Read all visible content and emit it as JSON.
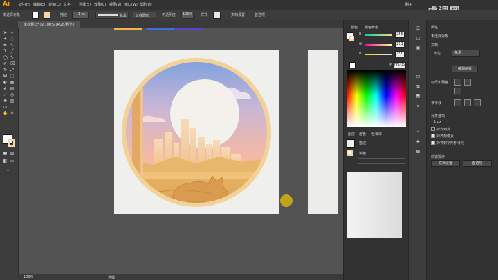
{
  "app": {
    "logo": "Ai"
  },
  "menubar": {
    "items": [
      "文件(F)",
      "编辑(E)",
      "对象(O)",
      "文字(T)",
      "选择(S)",
      "效果(C)",
      "视图(V)",
      "窗口(W)",
      "帮助(H)"
    ],
    "user": "刷子"
  },
  "watermark": "虎课网",
  "controlbar": {
    "no_selection": "未选择对象",
    "stroke_label": "描边",
    "stroke_weight": "1 pt",
    "stroke_style": "基本",
    "brush_label": "5 点圆形",
    "opacity_label": "不透明度",
    "opacity_value": "100%",
    "style_label": "样式",
    "doc_setup": "文档设置",
    "prefs": "首选项"
  },
  "document": {
    "tab_title": "未标题-3* @ 100% (RGB/预览)",
    "zoom": "100%",
    "status_tool": "选择"
  },
  "color_panel": {
    "tab_color": "颜色",
    "tab_guide": "颜色参考",
    "r_value": "255",
    "g_value": "211",
    "b_value": "150",
    "hex_label": "#",
    "hex_value": "FFD396",
    "r_label": "R",
    "g_label": "G",
    "b_label": "B"
  },
  "layers_panel": {
    "tab_layers": "图层",
    "tab_artboards": "画板",
    "tab_swatches": "色板库",
    "row1": "描边",
    "row2": "填色"
  },
  "properties_panel": {
    "title": "属性",
    "no_selection": "未选择对象",
    "doc_section": "文档",
    "units_label": "单位:",
    "units_value": "像素",
    "edit_artboard_btn": "编辑画板",
    "ruler_section": "标尺和网格",
    "guides_section": "参考线",
    "snap_section": "对齐选项",
    "snap_spacing": "1 px",
    "snap_opt1": "对齐到点",
    "snap_opt2": "对齐到像素",
    "snap_opt3": "对齐到字形参考线",
    "quick_section": "快速操作",
    "doc_setup_btn": "文档设置",
    "prefs_btn": "首选项"
  },
  "colors": {
    "accent": "#ff9a00",
    "ring": "#f2d297",
    "fill": "#dba359",
    "tab1": "#f6b24b",
    "tab2": "#3c6fe0",
    "tab3": "#5d3fd3"
  }
}
